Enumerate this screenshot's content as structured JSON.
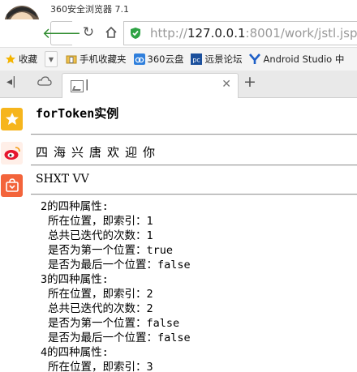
{
  "browser": {
    "app_title": "360安全浏览器 7.1",
    "url": {
      "prefix": "http://",
      "host": "127.0.0.1",
      "rest": ":8001/work/jstl.jsp"
    }
  },
  "bookmarks": [
    {
      "label": "收藏",
      "icon": "star-folder-icon"
    },
    {
      "label": "手机收藏夹",
      "icon": "phone-folder-icon"
    },
    {
      "label": "360云盘",
      "icon": "cloud-disk-icon"
    },
    {
      "label": "远景论坛",
      "icon": "pc-forum-icon"
    },
    {
      "label": "Android Studio 中",
      "icon": "android-y-icon"
    }
  ],
  "tab": {
    "title": "|"
  },
  "page": {
    "title": "forToken实例",
    "words": "四海兴唐欢迎你",
    "names": "SHXT VV",
    "iteration_lines": [
      {
        "text": "2的四种属性:",
        "sub": false
      },
      {
        "text": "所在位置，即索引：1",
        "sub": true
      },
      {
        "text": "总共已迭代的次数：1",
        "sub": true
      },
      {
        "text": "是否为第一个位置：true",
        "sub": true
      },
      {
        "text": "是否为最后一个位置：false",
        "sub": true
      },
      {
        "text": "3的四种属性:",
        "sub": false
      },
      {
        "text": "所在位置，即索引：2",
        "sub": true
      },
      {
        "text": "总共已迭代的次数：2",
        "sub": true
      },
      {
        "text": "是否为第一个位置：false",
        "sub": true
      },
      {
        "text": "是否为最后一个位置：false",
        "sub": true
      },
      {
        "text": "4的四种属性:",
        "sub": false
      },
      {
        "text": "所在位置，即索引：3",
        "sub": true
      }
    ]
  },
  "colors": {
    "accent_green": "#2e8b2e",
    "bookmark_bar": "#f4f4f4",
    "star": "#f6b51d",
    "shop": "#f3643b"
  }
}
